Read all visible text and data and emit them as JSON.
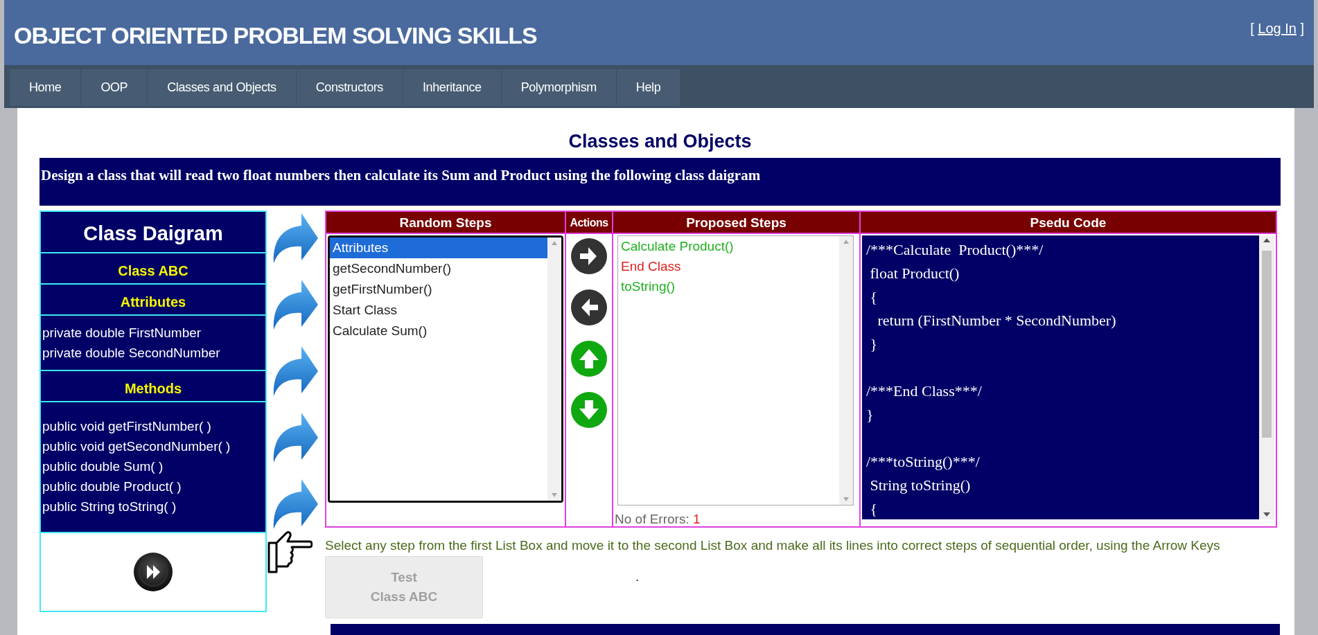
{
  "header": {
    "title": "OBJECT ORIENTED PROBLEM SOLVING SKILLS",
    "login": {
      "open": "[",
      "link": "Log In",
      "close": "]"
    }
  },
  "nav": [
    {
      "label": "Home"
    },
    {
      "label": "OOP"
    },
    {
      "label": "Classes and Objects"
    },
    {
      "label": "Constructors"
    },
    {
      "label": "Inheritance"
    },
    {
      "label": "Polymorphism"
    },
    {
      "label": "Help"
    }
  ],
  "page_title": "Classes and Objects",
  "task": "Design a class that will read two float numbers then calculate its Sum and Product using the following class daigram",
  "class_diagram": {
    "title": "Class Daigram",
    "class_name": "Class ABC",
    "attributes_heading": "Attributes",
    "attributes": [
      "private double FirstNumber",
      "private double SecondNumber"
    ],
    "methods_heading": "Methods",
    "methods": [
      "public void getFirstNumber( )",
      "public void getSecondNumber( )",
      "public double Sum( )",
      "public double Product( )",
      "public String toString( )"
    ]
  },
  "columns": [
    "Random Steps",
    "Actions",
    "Proposed Steps",
    "Psedu Code"
  ],
  "random_steps": [
    {
      "label": "Attributes",
      "selected": true
    },
    {
      "label": "getSecondNumber()",
      "selected": false
    },
    {
      "label": "getFirstNumber()",
      "selected": false
    },
    {
      "label": "Start Class",
      "selected": false
    },
    {
      "label": "Calculate Sum()",
      "selected": false
    }
  ],
  "actions": [
    {
      "kind": "right"
    },
    {
      "kind": "left"
    },
    {
      "kind": "up"
    },
    {
      "kind": "down"
    }
  ],
  "proposed_steps": [
    {
      "label": "Calculate Product()",
      "correct": true
    },
    {
      "label": "End Class",
      "correct": false
    },
    {
      "label": "toString()",
      "correct": true
    }
  ],
  "errors": {
    "label": "No of Errors:",
    "value": "1"
  },
  "pseudo_code": [
    [
      "/***Calculate  Product()***/",
      " float Product()",
      " {",
      "   return (FirstNumber * SecondNumber)",
      " }"
    ],
    [
      "/***End Class***/",
      "}"
    ],
    [
      "/***toString()***/",
      " String toString()",
      " {"
    ]
  ],
  "instruction": "Select any step from the first List Box and move it to the second List Box and make all its lines into correct steps of sequential order, using the Arrow Keys",
  "test_button": {
    "line1": "Test",
    "line2": "Class ABC",
    "disabled": true
  },
  "dot": "."
}
